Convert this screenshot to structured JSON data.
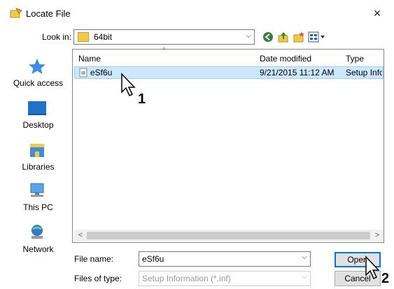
{
  "window": {
    "title": "Locate File",
    "close_label": "×"
  },
  "look_in": {
    "label": "Look in:",
    "value": "64bit"
  },
  "places": [
    {
      "label": "Quick access",
      "icon": "quick-access-star-icon"
    },
    {
      "label": "Desktop",
      "icon": "desktop-icon"
    },
    {
      "label": "Libraries",
      "icon": "libraries-icon"
    },
    {
      "label": "This PC",
      "icon": "computer-icon"
    },
    {
      "label": "Network",
      "icon": "network-icon"
    }
  ],
  "file_list": {
    "columns": [
      "Name",
      "Date modified",
      "Type"
    ],
    "rows": [
      {
        "name": "eSf6u",
        "date_modified": "9/21/2015 11:12 AM",
        "type": "Setup Infc"
      }
    ]
  },
  "file_name": {
    "label": "File name:",
    "value": "eSf6u"
  },
  "files_of_type": {
    "label": "Files of type:",
    "value": "Setup Information (*.inf)"
  },
  "buttons": {
    "open": "Open",
    "cancel": "Cancel"
  },
  "callouts": [
    "1",
    "2"
  ],
  "colors": {
    "selection": "#cce8ff",
    "selection_border": "#99d1ff",
    "accent": "#0078d7"
  }
}
